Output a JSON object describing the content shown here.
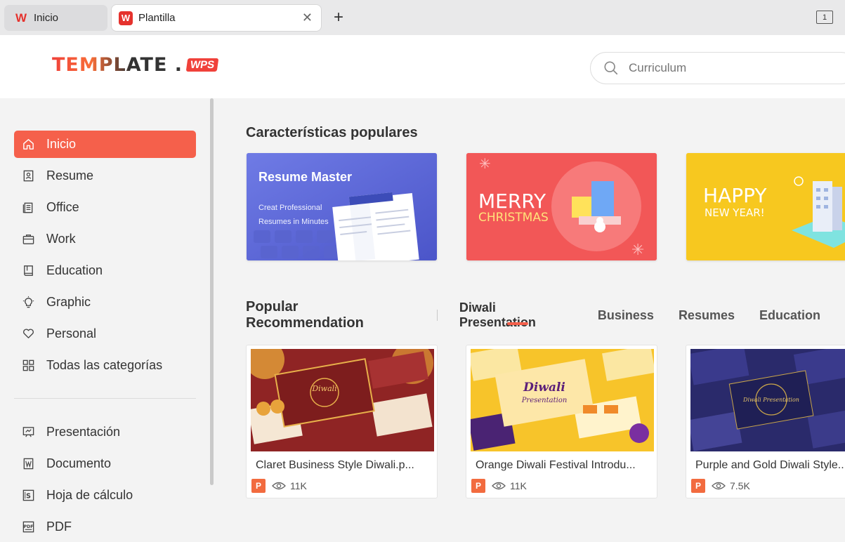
{
  "tabs": [
    {
      "label": "Inicio",
      "icon": "wps-logo-icon"
    },
    {
      "label": "Plantilla",
      "icon": "wps-logo-icon"
    }
  ],
  "window": {
    "counter": "1"
  },
  "header": {
    "brand": "TEMPLATE .",
    "brand_suffix": "WPS",
    "search_placeholder": "Curriculum"
  },
  "sidebar": {
    "items": [
      {
        "label": "Inicio",
        "icon": "home-icon",
        "active": true
      },
      {
        "label": "Resume",
        "icon": "resume-icon"
      },
      {
        "label": "Office",
        "icon": "office-icon"
      },
      {
        "label": "Work",
        "icon": "briefcase-icon"
      },
      {
        "label": "Education",
        "icon": "book-icon"
      },
      {
        "label": "Graphic",
        "icon": "bulb-icon"
      },
      {
        "label": "Personal",
        "icon": "heart-icon"
      },
      {
        "label": "Todas las categorías",
        "icon": "grid-icon"
      }
    ],
    "types": [
      {
        "label": "Presentación",
        "icon": "presentation-icon"
      },
      {
        "label": "Documento",
        "icon": "document-icon"
      },
      {
        "label": "Hoja de cálculo",
        "icon": "spreadsheet-icon"
      },
      {
        "label": "PDF",
        "icon": "pdf-icon"
      }
    ]
  },
  "popular": {
    "title": "Características populares",
    "banners": [
      {
        "title": "Resume Master",
        "line1": "Creat Professional",
        "line2": "Resumes in Minutes"
      },
      {
        "title": "MERRY",
        "subtitle": "CHRISTMAS"
      },
      {
        "title": "HAPPY",
        "subtitle": "NEW YEAR!"
      }
    ]
  },
  "recommend": {
    "title": "Popular Recommendation",
    "tabs": [
      "Diwali Presentation",
      "Business",
      "Resumes",
      "Education"
    ],
    "active_tab": 0,
    "cards": [
      {
        "title": "Claret Business Style Diwali.p...",
        "views": "11K",
        "type": "P"
      },
      {
        "title": "Orange Diwali Festival Introdu...",
        "views": "11K",
        "type": "P"
      },
      {
        "title": "Purple and Gold Diwali Style...",
        "views": "7.5K",
        "type": "P"
      }
    ]
  },
  "colors": {
    "accent": "#f5604b",
    "wps_red": "#e5322d"
  }
}
